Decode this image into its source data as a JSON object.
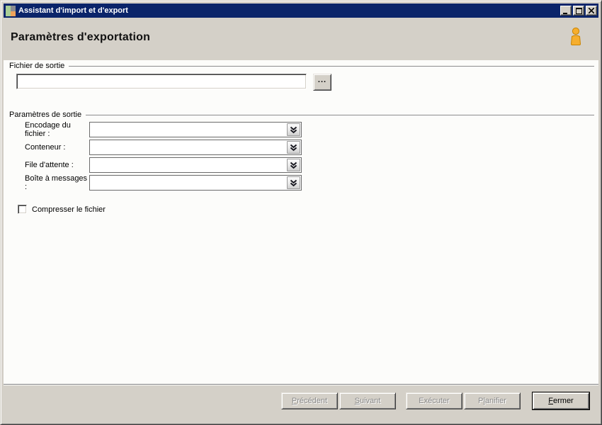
{
  "window": {
    "title": "Assistant d'import et d'export"
  },
  "header": {
    "title": "Paramètres d'exportation"
  },
  "output_file": {
    "group_label": "Fichier de sortie",
    "path_value": "",
    "browse_label": "..."
  },
  "output_params": {
    "group_label": "Paramètres de sortie",
    "fields": [
      {
        "label": "Encodage du fichier :",
        "value": ""
      },
      {
        "label": "Conteneur :",
        "value": ""
      },
      {
        "label": "File d'attente :",
        "value": ""
      },
      {
        "label": "Boîte à messages :",
        "value": ""
      }
    ],
    "compress_checkbox": {
      "label": "Compresser le fichier",
      "checked": false
    }
  },
  "footer": {
    "buttons": [
      {
        "name": "previous",
        "pre": "",
        "accel": "P",
        "post": "récédent",
        "enabled": false
      },
      {
        "name": "next",
        "pre": "",
        "accel": "S",
        "post": "uivant",
        "enabled": false
      },
      {
        "name": "execute",
        "pre": "",
        "accel": "",
        "post": "Exécuter",
        "enabled": false
      },
      {
        "name": "schedule",
        "pre": "P",
        "accel": "l",
        "post": "anifier",
        "enabled": false
      },
      {
        "name": "close",
        "pre": "",
        "accel": "F",
        "post": "ermer",
        "enabled": true
      }
    ]
  },
  "icons": {
    "titlebar_app": "colored-squares-app-icon",
    "minimize": "minimize-icon",
    "maximize": "maximize-icon",
    "close": "close-icon",
    "header_person": "person-icon",
    "combo_drop": "double-chevron-down-icon"
  },
  "colors": {
    "titlebar": "#0a246a",
    "chrome": "#d4d0c8",
    "content_bg": "#fcfcfa",
    "person_fill": "#f6ae2d",
    "person_outline": "#c98300",
    "disabled_text": "#8a8a8a"
  }
}
